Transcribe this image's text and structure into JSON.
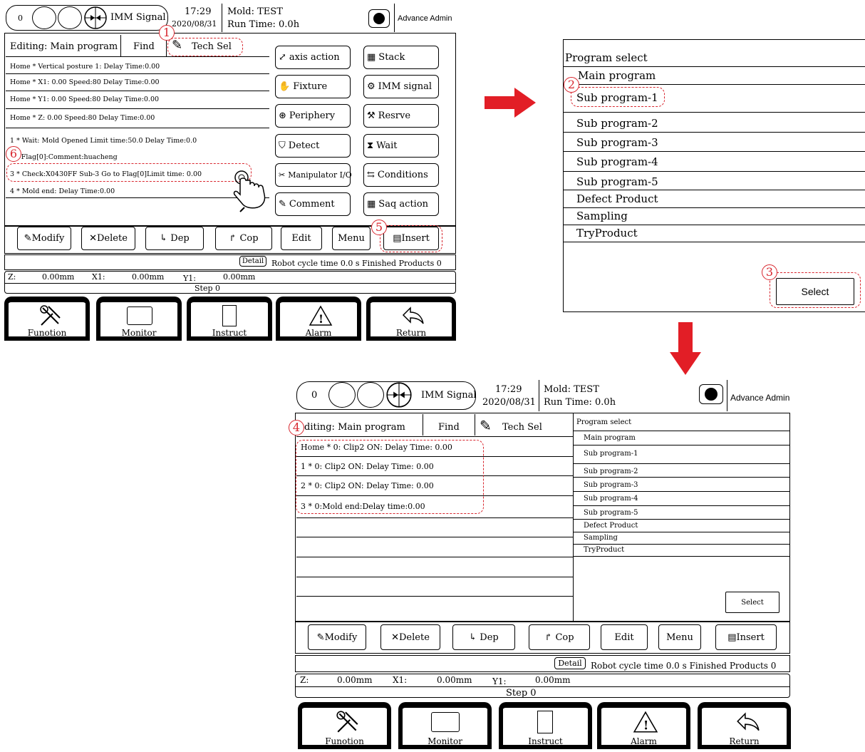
{
  "colors": {
    "annotation": "#d8262e",
    "line": "#000000"
  },
  "screens": {
    "status": {
      "counter": "0",
      "imm_signal": "IMM Signal",
      "time": "17:29",
      "date": "2020/08/31",
      "mold": "Mold: TEST",
      "run_time": "Run Time: 0.0h",
      "user": "Advance Admin"
    },
    "tabs": {
      "editing": "Editing: Main program",
      "editing_cut": "diting: Main program",
      "find": "Find",
      "tech_sel": "Tech Sel"
    },
    "program_lines_1": [
      "Home   *  Vertical posture 1: Delay Time:0.00",
      "Home   *  X1: 0.00 Speed:80  Delay Time:0.00",
      "Home   *  Y1: 0.00 Speed:80  Delay Time:0.00",
      "Home   *  Z: 0.00 Speed:80   Delay Time:0.00",
      "1    *  Wait: Mold Opened Limit time:50.0  Delay Time:0.0",
      "      *   #Flag[0]:Comment:huacheng",
      "3     *   Check:X0430FF Sub-3 Go to Flag[0]Limit time: 0.00",
      "4     *   Mold end:   Delay Time:0.00"
    ],
    "program_lines_2": [
      "Home   * 0: Clip2 ON: Delay Time: 0.00",
      "1  *  0: Clip2 ON: Delay Time: 0.00",
      "2  *  0: Clip2 ON: Delay Time: 0.00",
      "3  *  0:Mold end:Delay time:0.00"
    ],
    "actions": [
      "axis action",
      "Stack",
      "Fixture",
      "IMM signal",
      "Periphery",
      "Resrve",
      "Detect",
      "Wait",
      "Manipulator I/O",
      "Conditions",
      "Comment",
      "Saq action"
    ],
    "toolbar": [
      "Modify",
      "Delete",
      "Dep",
      "Cop",
      "Edit",
      "Menu",
      "Insert"
    ],
    "detail": "Detail",
    "cycle": "Robot cycle time 0.0 s Finished Products  0",
    "axes": {
      "z": "Z:",
      "z_val": "0.00mm",
      "x1": "X1:",
      "x1_val": "0.00mm",
      "y1": "Y1:",
      "y1_val": "0.00mm"
    },
    "step": "Step    0",
    "nav": [
      "Funotion",
      "Monitor",
      "Instruct",
      "Alarm",
      "Return"
    ],
    "program_select": {
      "title": "Program select",
      "items": [
        "Main program",
        "Sub program-1",
        "Sub program-2",
        "Sub program-3",
        "Sub program-4",
        "Sub program-5",
        "Defect Product",
        "Sampling",
        "TryProduct"
      ],
      "select_btn": "Select"
    },
    "badges": [
      "1",
      "2",
      "3",
      "4",
      "5",
      "6"
    ]
  }
}
